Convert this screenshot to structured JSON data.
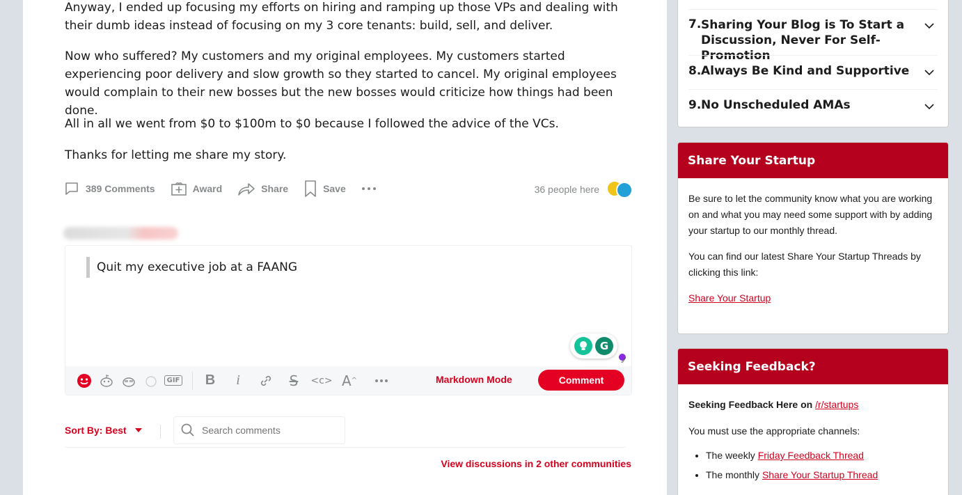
{
  "post": {
    "paragraph_1": "Anyway, I ended up focusing my efforts on hiring and ramping up those VPs and dealing with their dumb ideas instead of focusing on my 3 core tenants: build, sell, and deliver.",
    "paragraph_2": "Now who suffered? My customers and my original employees. My customers started experiencing poor delivery and slow growth so they started to cancel. My original employees would complain to their new bosses but the new bosses would criticize how things had been done.",
    "paragraph_3": "All in all we went from $0 to $100m to $0 because I followed the advice of the VCs.",
    "paragraph_4": "Thanks for letting me share my story."
  },
  "actions": {
    "comments": "389 Comments",
    "award": "Award",
    "share": "Share",
    "save": "Save",
    "people_here": "36 people here"
  },
  "editor": {
    "quote_text": "Quit my executive job at a FAANG",
    "markdown_mode": "Markdown Mode",
    "comment_button": "Comment",
    "gif_label": "GIF"
  },
  "comments_bar": {
    "sort_label": "Sort By: Best",
    "search_placeholder": "Search comments",
    "view_discussions": "View discussions in 2 other communities"
  },
  "rules": [
    {
      "num": "7.",
      "line1": "Sharing Your Blog is To Start a",
      "line2": "Discussion, Never For Self-Promotion"
    },
    {
      "num": "8.",
      "line1": "Always Be Kind and Supportive",
      "line2": ""
    },
    {
      "num": "9.",
      "line1": "No Unscheduled AMAs",
      "line2": ""
    }
  ],
  "share_card": {
    "title": "Share Your Startup",
    "text_1": "Be sure to let the community know what you are working on and what you may need some support with by adding your startup to our monthly thread.",
    "text_2": "You can find our latest Share Your Startup Threads by clicking this link:",
    "link": "Share Your Startup"
  },
  "seek_card": {
    "title": "Seeking Feedback?",
    "heading_prefix": "Seeking Feedback Here on",
    "heading_link": "/r/startups",
    "channels_text": "You must use the appropriate channels:",
    "item_1_prefix": "The weekly",
    "item_1_link": "Friday Feedback Thread",
    "item_2_prefix": "The monthly",
    "item_2_link": "Share Your Startup Thread"
  },
  "colors": {
    "accent": "#d4001e",
    "card_header": "#b5001e",
    "comment_button": "#e30022",
    "background": "#dae0e6"
  }
}
